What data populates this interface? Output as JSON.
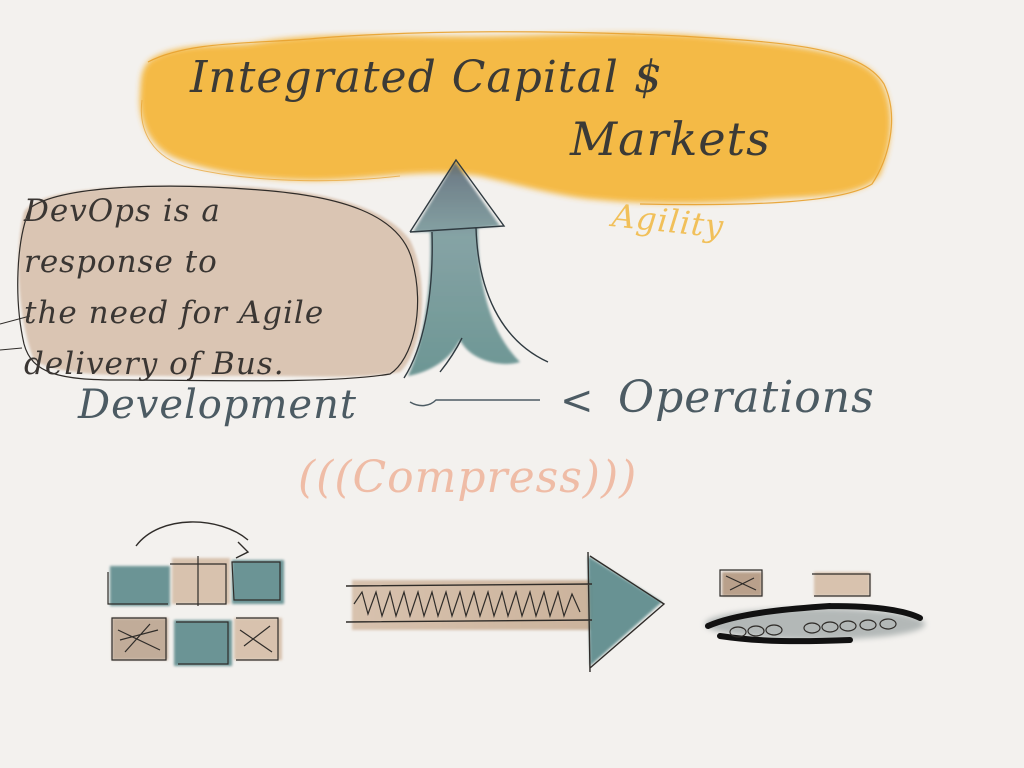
{
  "title": {
    "line1": "Integrated Capital $",
    "line2": "Markets"
  },
  "agility": "Agility",
  "note": {
    "lines": [
      "DevOps is a",
      "response to",
      "the need for Agile",
      "delivery of Bus."
    ]
  },
  "development": "Development",
  "ops_mark": "<",
  "operations": "Operations",
  "compress": "(((Compress)))",
  "colors": {
    "cloud": "#f5b638",
    "note_fill": "#d9c3b0",
    "teal": "#5d8b8c",
    "tan": "#d8c2ae",
    "ink": "#3b3a36",
    "compress": "#efbca6"
  }
}
